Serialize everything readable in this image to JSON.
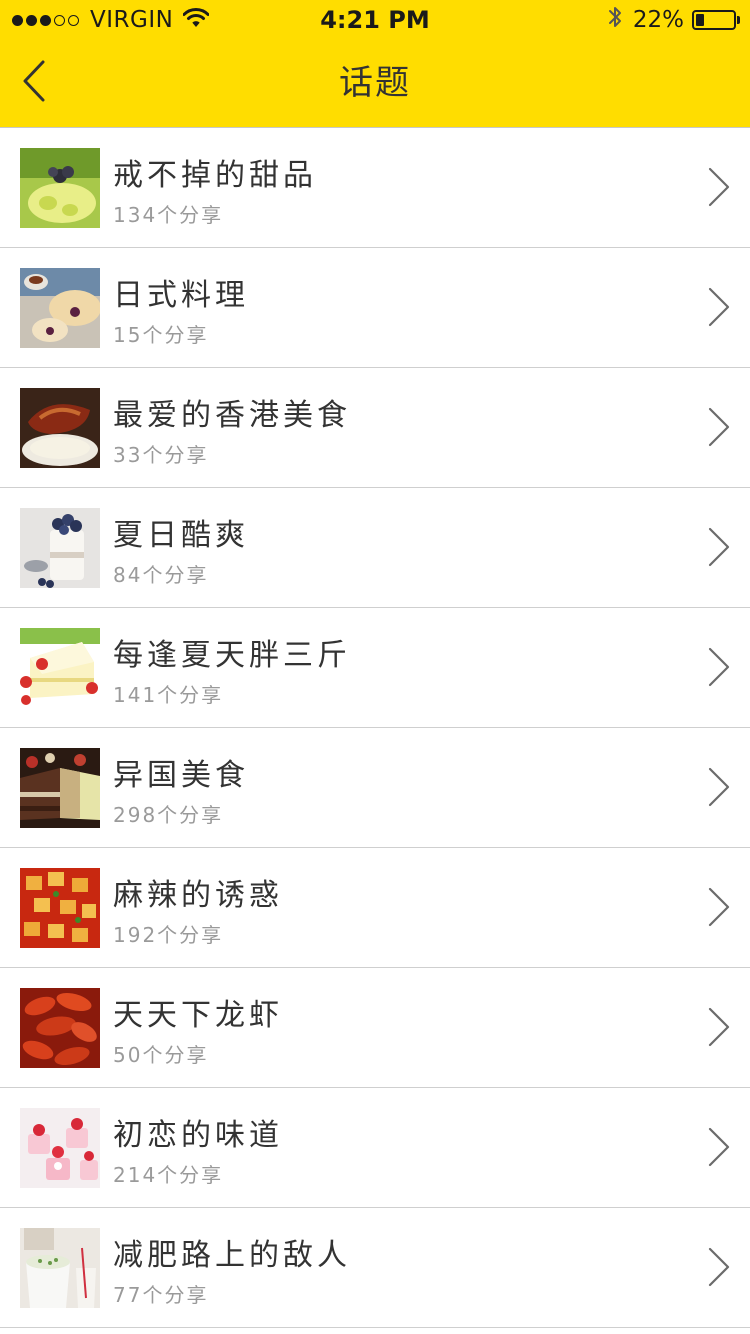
{
  "status_bar": {
    "carrier": "VIRGIN",
    "time": "4:21 PM",
    "battery_percent": "22%",
    "battery_level": 0.22,
    "signal_bars_filled": 3,
    "signal_bars_total": 5,
    "icons": [
      "wifi-icon",
      "bluetooth-icon",
      "battery-icon"
    ]
  },
  "nav": {
    "title": "话题",
    "back_icon": "chevron-left-icon"
  },
  "topics": [
    {
      "title": "戒不掉的甜品",
      "count": "134个分享",
      "thumb": "dessert-image"
    },
    {
      "title": "日式料理",
      "count": "15个分享",
      "thumb": "japanese-food-image"
    },
    {
      "title": "最爱的香港美食",
      "count": "33个分享",
      "thumb": "hongkong-food-image"
    },
    {
      "title": "夏日酷爽",
      "count": "84个分享",
      "thumb": "summer-dessert-image"
    },
    {
      "title": "每逢夏天胖三斤",
      "count": "141个分享",
      "thumb": "cake-image"
    },
    {
      "title": "异国美食",
      "count": "298个分享",
      "thumb": "foreign-cake-image"
    },
    {
      "title": "麻辣的诱惑",
      "count": "192个分享",
      "thumb": "spicy-tofu-image"
    },
    {
      "title": "天天下龙虾",
      "count": "50个分享",
      "thumb": "crayfish-image"
    },
    {
      "title": "初恋的味道",
      "count": "214个分享",
      "thumb": "strawberry-cake-image"
    },
    {
      "title": "减肥路上的敌人",
      "count": "77个分享",
      "thumb": "snack-cup-image"
    }
  ],
  "colors": {
    "nav_background": "#FFDD00",
    "title_text": "#333333",
    "subtitle_text": "#9A9A9A",
    "divider": "#CFCFCF"
  }
}
